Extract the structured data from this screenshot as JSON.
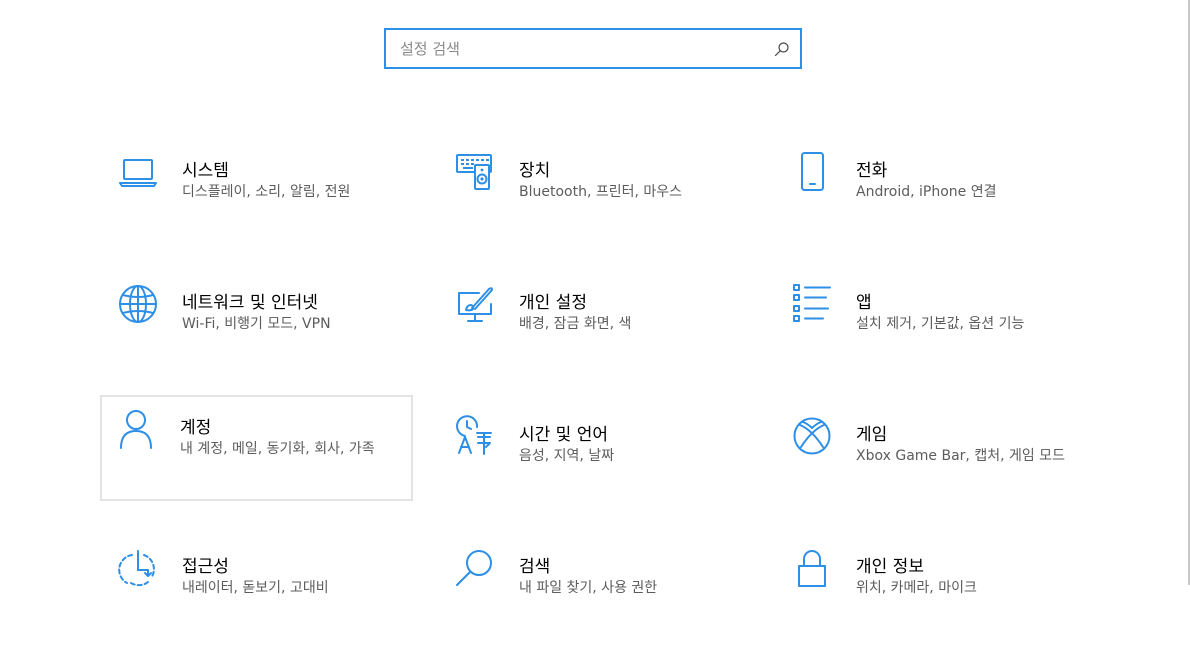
{
  "search": {
    "placeholder": "설정 검색",
    "icon": "search-icon"
  },
  "accent_color": "#2d8fe6",
  "tiles": [
    {
      "title": "시스템",
      "description": "디스플레이, 소리, 알림, 전원",
      "icon": "laptop-icon"
    },
    {
      "title": "장치",
      "description": "Bluetooth, 프린터, 마우스",
      "icon": "keyboard-speaker-icon"
    },
    {
      "title": "전화",
      "description": "Android, iPhone 연결",
      "icon": "phone-icon"
    },
    {
      "title": "네트워크 및 인터넷",
      "description": "Wi-Fi, 비행기 모드, VPN",
      "icon": "globe-icon"
    },
    {
      "title": "개인 설정",
      "description": "배경, 잠금 화면, 색",
      "icon": "paint-monitor-icon"
    },
    {
      "title": "앱",
      "description": "설치 제거, 기본값, 옵션 기능",
      "icon": "app-list-icon"
    },
    {
      "title": "계정",
      "description": "내 계정, 메일, 동기화, 회사, 가족",
      "icon": "person-icon"
    },
    {
      "title": "시간 및 언어",
      "description": "음성, 지역, 날짜",
      "icon": "time-language-icon"
    },
    {
      "title": "게임",
      "description": "Xbox Game Bar, 캡처, 게임 모드",
      "icon": "xbox-icon"
    },
    {
      "title": "접근성",
      "description": "내레이터, 돋보기, 고대비",
      "icon": "accessibility-icon"
    },
    {
      "title": "검색",
      "description": "내 파일 찾기, 사용 권한",
      "icon": "magnifier-icon"
    },
    {
      "title": "개인 정보",
      "description": "위치, 카메라, 마이크",
      "icon": "lock-icon"
    }
  ]
}
